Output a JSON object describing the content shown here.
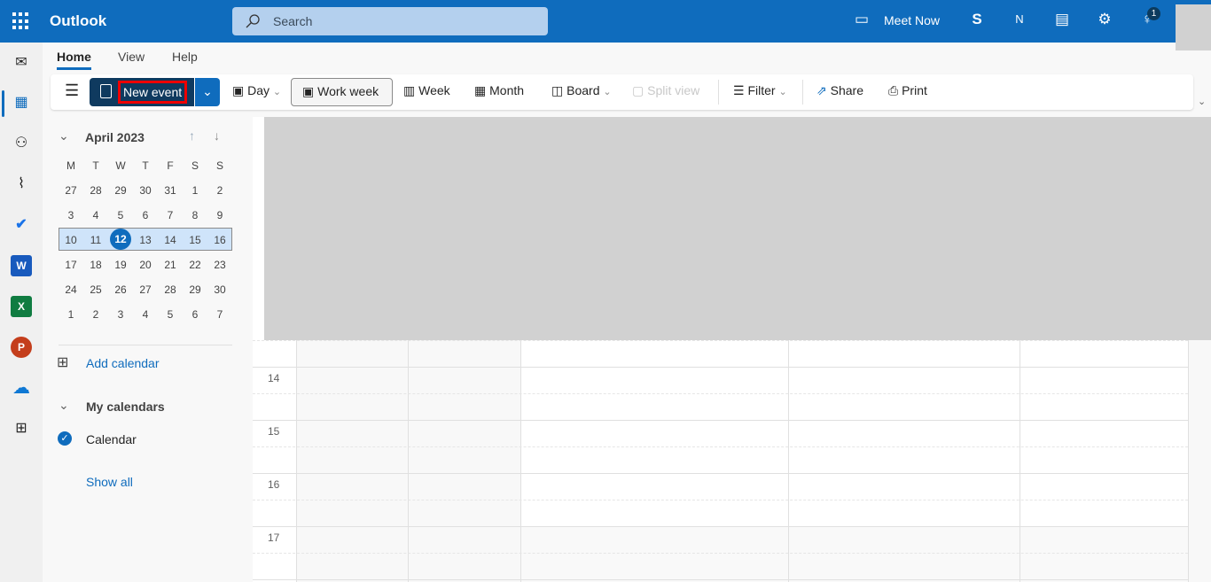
{
  "app": {
    "title": "Outlook",
    "search_placeholder": "Search",
    "meet_now": "Meet Now",
    "notification_count": "1"
  },
  "menu_tabs": [
    "Home",
    "View",
    "Help"
  ],
  "active_tab": "Home",
  "ribbon": {
    "new_event": "New event",
    "day": "Day",
    "work_week": "Work week",
    "week": "Week",
    "month": "Month",
    "board": "Board",
    "split_view": "Split view",
    "filter": "Filter",
    "share": "Share",
    "print": "Print"
  },
  "mini_calendar": {
    "month_label": "April 2023",
    "weekdays": [
      "M",
      "T",
      "W",
      "T",
      "F",
      "S",
      "S"
    ],
    "weeks": [
      [
        "27",
        "28",
        "29",
        "30",
        "31",
        "1",
        "2"
      ],
      [
        "3",
        "4",
        "5",
        "6",
        "7",
        "8",
        "9"
      ],
      [
        "10",
        "11",
        "12",
        "13",
        "14",
        "15",
        "16"
      ],
      [
        "17",
        "18",
        "19",
        "20",
        "21",
        "22",
        "23"
      ],
      [
        "24",
        "25",
        "26",
        "27",
        "28",
        "29",
        "30"
      ],
      [
        "1",
        "2",
        "3",
        "4",
        "5",
        "6",
        "7"
      ]
    ],
    "today": "12",
    "selected_week_index": 2
  },
  "sidebar": {
    "add_calendar": "Add calendar",
    "my_calendars": "My calendars",
    "calendar": "Calendar",
    "show_all": "Show all"
  },
  "grid": {
    "hours": [
      "14",
      "15",
      "16",
      "17"
    ]
  },
  "colors": {
    "brand": "#0f6cbd",
    "selected_week": "#cfe4fa",
    "highlight": "#e00000"
  }
}
